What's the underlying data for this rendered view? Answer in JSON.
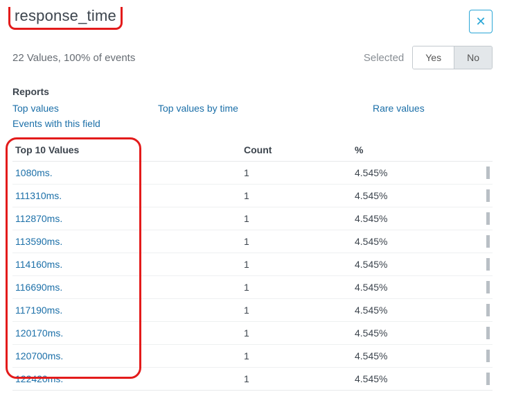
{
  "field_name": "response_time",
  "summary": "22 Values, 100% of events",
  "selected_label": "Selected",
  "toggle": {
    "yes": "Yes",
    "no": "No",
    "active": "no"
  },
  "close_glyph": "✕",
  "reports": {
    "heading": "Reports",
    "links": {
      "top_values": "Top values",
      "top_values_by_time": "Top values by time",
      "rare_values": "Rare values",
      "events_with_field": "Events with this field"
    }
  },
  "table": {
    "heading_values": "Top 10 Values",
    "heading_count": "Count",
    "heading_pct": "%",
    "rows": [
      {
        "value": "1080ms.",
        "count": "1",
        "pct": "4.545%"
      },
      {
        "value": "111310ms.",
        "count": "1",
        "pct": "4.545%"
      },
      {
        "value": "112870ms.",
        "count": "1",
        "pct": "4.545%"
      },
      {
        "value": "113590ms.",
        "count": "1",
        "pct": "4.545%"
      },
      {
        "value": "114160ms.",
        "count": "1",
        "pct": "4.545%"
      },
      {
        "value": "116690ms.",
        "count": "1",
        "pct": "4.545%"
      },
      {
        "value": "117190ms.",
        "count": "1",
        "pct": "4.545%"
      },
      {
        "value": "120170ms.",
        "count": "1",
        "pct": "4.545%"
      },
      {
        "value": "120700ms.",
        "count": "1",
        "pct": "4.545%"
      },
      {
        "value": "122420ms.",
        "count": "1",
        "pct": "4.545%"
      }
    ]
  }
}
